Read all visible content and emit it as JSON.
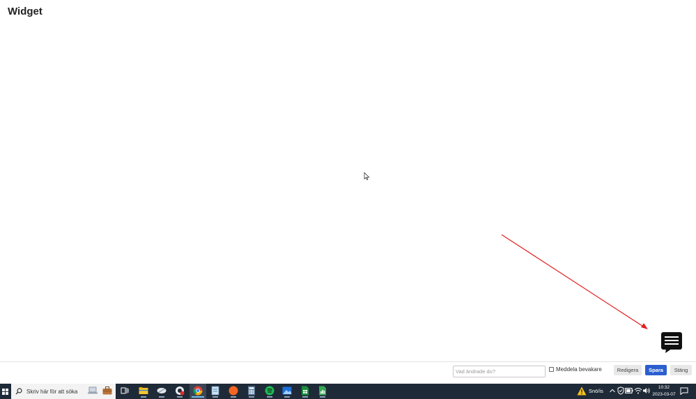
{
  "page": {
    "title": "Widget"
  },
  "editor_bar": {
    "summary_placeholder": "Vad ändrade du?",
    "notify_label": "Meddela bevakare",
    "notify_checked": false,
    "edit_label": "Redigera",
    "save_label": "Spara",
    "close_label": "Stäng",
    "save_color": "#2b5fcf"
  },
  "taskbar": {
    "search_placeholder": "Skriv här för att söka",
    "apps": [
      "laptop-icon",
      "briefcase-icon",
      "task-view-icon",
      "file-explorer-icon",
      "feather-app-icon",
      "edge-icon",
      "chrome-icon",
      "notepad-icon",
      "compass-icon",
      "calculator-icon",
      "spotify-icon",
      "photos-icon",
      "spreadsheet-icon",
      "spreadsheet-chart-icon"
    ],
    "weather_text": "Snö/is",
    "clock_time": "10:32",
    "clock_date": "2023-03-07",
    "background_color": "#1f2a38"
  }
}
